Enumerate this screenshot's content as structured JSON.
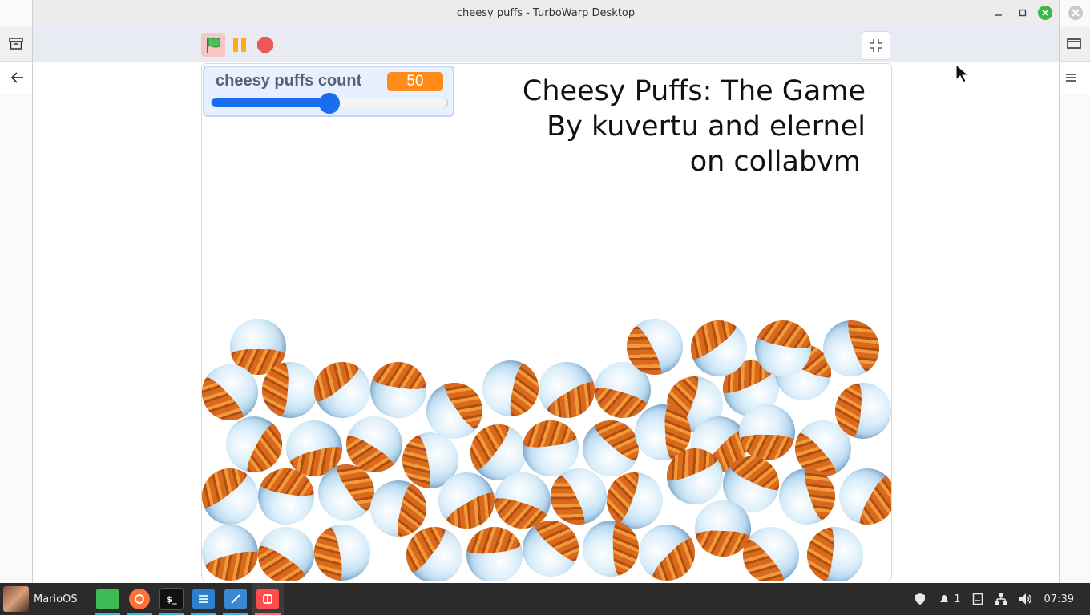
{
  "window": {
    "title": "cheesy puffs - TurboWarp Desktop",
    "controls": {
      "minimize": "–",
      "maximize": "☐",
      "close": "✕"
    }
  },
  "player": {
    "green_flag_icon": "flag-icon",
    "pause_icon": "pause-icon",
    "stop_icon": "stop-icon",
    "exit_fullscreen_icon": "exit-fullscreen-icon"
  },
  "monitor": {
    "label": "cheesy puffs count",
    "value": "50",
    "slider_fraction": 0.5
  },
  "stage": {
    "title_lines": [
      "Cheesy Puffs: The Game",
      "By kuvertu and elernel",
      "on collabvm"
    ]
  },
  "taskbar": {
    "start_label": "MarioOS",
    "apps": [
      {
        "name": "files",
        "color": "#3cba54"
      },
      {
        "name": "firefox",
        "color": "#ff7139"
      },
      {
        "name": "terminal",
        "color": "#111111"
      },
      {
        "name": "text-editor",
        "color": "#2d7fd0"
      },
      {
        "name": "drawing",
        "color": "#3a87d6"
      },
      {
        "name": "turbowarp",
        "color": "#ff4c4c"
      }
    ],
    "tray": {
      "notifications_count": "1",
      "clock": "07:39"
    }
  },
  "colors": {
    "accent": "#ff8c1a",
    "slider": "#1a6df0",
    "taskbar_bg": "#2b2b2b",
    "close_button": "#3db54a"
  }
}
